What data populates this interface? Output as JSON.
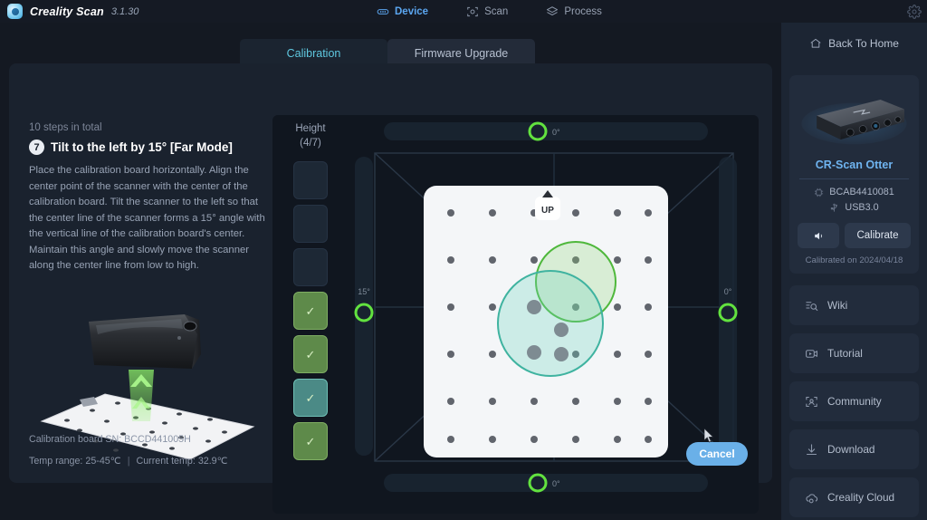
{
  "app": {
    "name": "Creality Scan",
    "version": "3.1.30",
    "logo_icon": "creality-logo-icon",
    "settings_icon": "gear-icon"
  },
  "topnav": {
    "items": [
      {
        "label": "Device",
        "icon": "device-icon",
        "active": true
      },
      {
        "label": "Scan",
        "icon": "scan-frame-icon",
        "active": false
      },
      {
        "label": "Process",
        "icon": "layers-icon",
        "active": false
      }
    ]
  },
  "tabs": [
    {
      "label": "Calibration",
      "active": true
    },
    {
      "label": "Firmware Upgrade",
      "active": false
    }
  ],
  "instructions": {
    "steps_total": "10 steps in total",
    "step_number": "7",
    "step_title": "Tilt to the left by 15° [Far Mode]",
    "step_body": "Place the calibration board horizontally. Align the center point of the scanner with the center of the calibration board. Tilt the scanner to the left so that the center line of the scanner forms a 15° angle with the vertical line of the calibration board's center. Maintain this angle and slowly move the scanner along the center line from low to high."
  },
  "board_info": {
    "sn_label": "Calibration board SN:",
    "sn_value": "BCCD441005H",
    "temp_range_label": "Temp range:",
    "temp_range_value": "25-45℃",
    "separator": "|",
    "current_temp_label": "Current temp:",
    "current_temp_value": "32.9℃"
  },
  "calibration_view": {
    "height_label": "Height",
    "height_progress": "(4/7)",
    "height_current": 4,
    "height_total": 7,
    "height_steps": [
      {
        "state": "pending",
        "check": ""
      },
      {
        "state": "pending",
        "check": ""
      },
      {
        "state": "pending",
        "check": ""
      },
      {
        "state": "done",
        "check": "✓"
      },
      {
        "state": "done",
        "check": "✓"
      },
      {
        "state": "current",
        "check": "✓"
      },
      {
        "state": "done",
        "check": "✓"
      }
    ],
    "board_up_marker": "UP",
    "angle_indicators": [
      {
        "position": "top",
        "label": "0°",
        "active": true
      },
      {
        "position": "bottom",
        "label": "0°",
        "active": true
      },
      {
        "position": "left",
        "label": "15°",
        "active": true
      },
      {
        "position": "right",
        "label": "0°",
        "active": true
      }
    ],
    "grid_columns": 6,
    "grid_rows": 7,
    "target_circle_color": "#5bbf4a",
    "current_circle_color": "#4fc2ae"
  },
  "actions": {
    "cancel_label": "Cancel",
    "cancel_color": "#6ab0e8"
  },
  "sidebar": {
    "back_home": {
      "label": "Back To Home",
      "icon": "home-icon"
    },
    "device": {
      "image_icon": "scanner-device-image",
      "name": "CR-Scan Otter",
      "serial_icon": "chip-icon",
      "serial": "BCAB4410081",
      "connection_icon": "usb-icon",
      "connection": "USB3.0",
      "sound_icon": "speaker-icon",
      "calibrate_label": "Calibrate",
      "calibrated_on": "Calibrated on 2024/04/18"
    },
    "menu": [
      {
        "label": "Wiki",
        "icon": "wiki-search-icon"
      },
      {
        "label": "Tutorial",
        "icon": "video-play-icon"
      },
      {
        "label": "Community",
        "icon": "community-icon"
      },
      {
        "label": "Download",
        "icon": "download-icon"
      },
      {
        "label": "Creality Cloud",
        "icon": "cloud-icon"
      }
    ]
  },
  "theme": {
    "bg": "#10141c",
    "panel": "#1a222e",
    "accent_blue": "#5ba6f0",
    "accent_teal": "#5fc8e0",
    "accent_green": "#5bbf4a"
  }
}
